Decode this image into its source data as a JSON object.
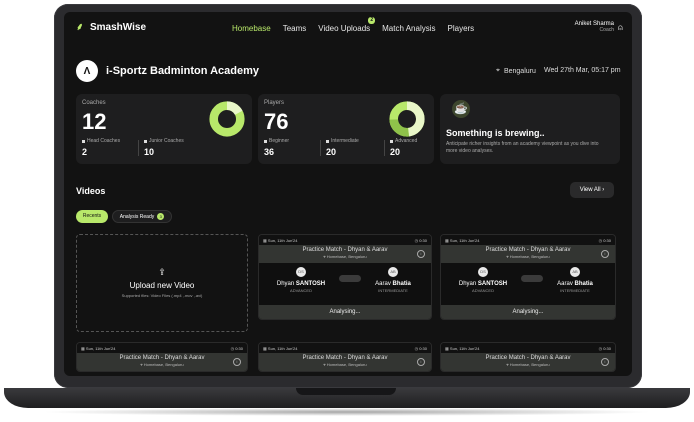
{
  "app": {
    "name": "SmashWise"
  },
  "nav": {
    "links": [
      {
        "label": "Homebase",
        "active": true
      },
      {
        "label": "Teams"
      },
      {
        "label": "Video Uploads",
        "badge": "2"
      },
      {
        "label": "Match Analysis"
      },
      {
        "label": "Players"
      }
    ],
    "user_name": "Aniket Sharma",
    "user_role": "Coach"
  },
  "academy": {
    "name": "i-Sportz Badminton Academy",
    "location": "Bengaluru",
    "datetime": "Wed 27th Mar, 05:17 pm"
  },
  "coaches": {
    "label": "Coaches",
    "total": "12",
    "head_label": "Head Coaches",
    "head_value": "2",
    "junior_label": "Junior Coaches",
    "junior_value": "10",
    "head_fraction": 0.17
  },
  "players": {
    "label": "Players",
    "total": "76",
    "beginner_label": "Beginner",
    "beginner_value": "36",
    "intermediate_label": "Intermediate",
    "intermediate_value": "20",
    "advanced_label": "Advanced",
    "advanced_value": "20"
  },
  "brewing": {
    "title": "Something is brewing..",
    "text": "Anticipate richer insights from an academy viewpoint as you dive into more video analyses."
  },
  "videos": {
    "title": "Videos",
    "view_all": "View All",
    "tab_recents": "Recents",
    "tab_ready": "Analysis Ready",
    "tab_ready_count": "3",
    "upload_title": "Upload new Video",
    "upload_sub": "Supported files: Video Files (.mp4 ,.mov ,.avi)"
  },
  "video_cards": [
    {
      "date": "Sun, 11th Jun'24",
      "duration": "0:30",
      "title": "Practice Match - Dhyan & Aarav",
      "venue": "Homebase, Bengaluru",
      "p1_first": "Dhyan",
      "p1_last": "SANTOSH",
      "p1_level": "ADVANCED",
      "p2_first": "Aarav",
      "p2_last": "Bhatia",
      "p2_level": "INTERMEDIATE",
      "status": "Analysing..."
    },
    {
      "date": "Sun, 11th Jun'24",
      "duration": "0:30",
      "title": "Practice Match - Dhyan & Aarav",
      "venue": "Homebase, Bengaluru",
      "p1_first": "Dhyan",
      "p1_last": "SANTOSH",
      "p1_level": "ADVANCED",
      "p2_first": "Aarav",
      "p2_last": "Bhatia",
      "p2_level": "INTERMEDIATE",
      "status": "Analysing..."
    },
    {
      "date": "Sun, 11th Jun'24",
      "duration": "0:30",
      "title": "Practice Match - Dhyan & Aarav",
      "venue": "Homebase, Bengaluru"
    },
    {
      "date": "Sun, 11th Jun'24",
      "duration": "0:30",
      "title": "Practice Match - Dhyan & Aarav",
      "venue": "Homebase, Bengaluru"
    },
    {
      "date": "Sun, 11th Jun'24",
      "duration": "0:30",
      "title": "Practice Match - Dhyan & Aarav",
      "venue": "Homebase, Bengaluru"
    }
  ],
  "colors": {
    "accent": "#b8e86a",
    "background": "#121212",
    "card": "#1e1e1f"
  }
}
